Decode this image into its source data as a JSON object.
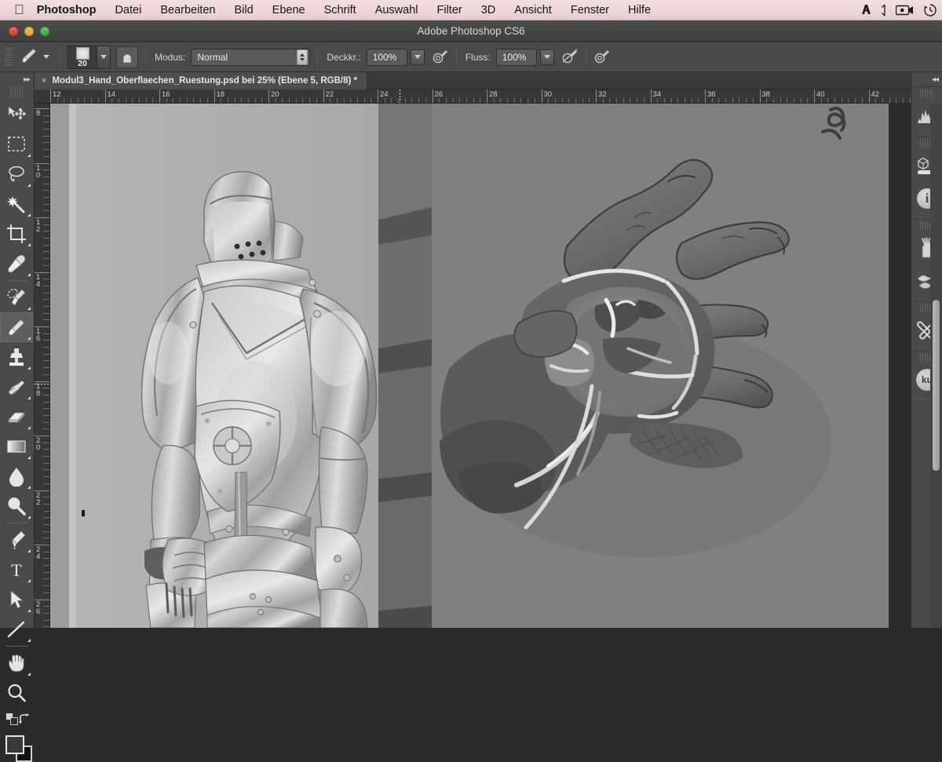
{
  "menubar": {
    "apple_icon": "apple-logo-icon",
    "items": [
      {
        "label": "Photoshop",
        "bold": true
      },
      {
        "label": "Datei"
      },
      {
        "label": "Bearbeiten"
      },
      {
        "label": "Bild"
      },
      {
        "label": "Ebene"
      },
      {
        "label": "Schrift"
      },
      {
        "label": "Auswahl"
      },
      {
        "label": "Filter"
      },
      {
        "label": "3D"
      },
      {
        "label": "Ansicht"
      },
      {
        "label": "Fenster"
      },
      {
        "label": "Hilfe"
      }
    ],
    "tray": [
      "adobe-cc-icon",
      "bluetooth-icon",
      "screen-recording-icon",
      "time-machine-icon"
    ],
    "background": "#ecd6d6"
  },
  "window": {
    "title": "Adobe Photoshop CS6",
    "traffic_lights": [
      "close",
      "minimize",
      "zoom"
    ]
  },
  "options_bar": {
    "tool_preset_icon": "brush-tool-icon",
    "brush_size": "20",
    "tablet_pressure_icon": "tablet-pressure-icon",
    "mode_label": "Modus:",
    "mode_value": "Normal",
    "opacity_label": "Deckkr.:",
    "opacity_value": "100%",
    "opacity_pressure_icon": "pressure-opacity-icon",
    "flow_label": "Fluss:",
    "flow_value": "100%",
    "flow_pressure_icon": "pressure-flow-icon",
    "airbrush_icon": "airbrush-icon"
  },
  "document": {
    "tab_close_glyph": "×",
    "tab_title": "Modul3_Hand_Oberflaechen_Ruestung.psd bei 25% (Ebene 5, RGB/8) *",
    "zoom": "25%",
    "layer": "Ebene 5",
    "color_mode": "RGB/8"
  },
  "rulers": {
    "horizontal_labels": [
      "12",
      "14",
      "16",
      "18",
      "20",
      "22",
      "24",
      "26",
      "28",
      "30",
      "32",
      "34",
      "36",
      "38",
      "40",
      "42"
    ],
    "vertical_labels": [
      "8",
      "10",
      "12",
      "14",
      "16",
      "18",
      "20",
      "22",
      "24",
      "26"
    ],
    "units_step": 2
  },
  "toolbar": {
    "collapse_glyph": "▸▸",
    "tools": [
      {
        "name": "move-tool",
        "label": "Verschieben"
      },
      {
        "name": "rectangular-marquee-tool",
        "label": "Auswahlrechteck"
      },
      {
        "name": "lasso-tool",
        "label": "Lasso"
      },
      {
        "name": "magic-wand-tool",
        "label": "Zauberstab"
      },
      {
        "name": "crop-tool",
        "label": "Freistellen"
      },
      {
        "name": "eyedropper-tool",
        "label": "Pipette"
      },
      {
        "name": "healing-brush-tool",
        "label": "Reparatur-Pinsel"
      },
      {
        "name": "brush-tool",
        "label": "Pinsel",
        "selected": true
      },
      {
        "name": "clone-stamp-tool",
        "label": "Kopierstempel"
      },
      {
        "name": "history-brush-tool",
        "label": "Protokollpinsel"
      },
      {
        "name": "eraser-tool",
        "label": "Radiergummi"
      },
      {
        "name": "gradient-tool",
        "label": "Verlauf"
      },
      {
        "name": "blur-tool",
        "label": "Weichzeichner"
      },
      {
        "name": "dodge-tool",
        "label": "Abwedler"
      },
      {
        "name": "pen-tool",
        "label": "Zeichenstift"
      },
      {
        "name": "type-tool",
        "label": "Text"
      },
      {
        "name": "path-selection-tool",
        "label": "Pfadauswahl"
      },
      {
        "name": "line-tool",
        "label": "Linie"
      },
      {
        "name": "hand-tool",
        "label": "Hand"
      },
      {
        "name": "zoom-tool",
        "label": "Zoom"
      }
    ],
    "swap_colors_icon": "swap-colors-icon",
    "default_colors_icon": "default-colors-icon",
    "foreground_color": "#3a3a3a",
    "background_color": "#111111"
  },
  "right_dock": {
    "collapse_glyph": "◂◂",
    "groups": [
      {
        "icons": [
          {
            "name": "histogram-panel-icon"
          }
        ]
      },
      {
        "icons": [
          {
            "name": "3d-panel-icon"
          },
          {
            "name": "info-panel-icon",
            "glyph": "i"
          }
        ]
      },
      {
        "icons": [
          {
            "name": "brush-panel-icon"
          },
          {
            "name": "brush-presets-panel-icon"
          }
        ]
      },
      {
        "icons": [
          {
            "name": "tool-presets-panel-icon"
          }
        ]
      },
      {
        "icons": [
          {
            "name": "kuler-panel-icon",
            "glyph": "ku"
          }
        ]
      }
    ]
  },
  "canvas": {
    "artboard_color": "#808080",
    "pasteboard_color": "#6f6f6f",
    "left_image_caption": "grayscale-photo-knight-armor",
    "right_image_caption": "digital-painting-armored-gauntlet",
    "scrollbar_visible": true
  }
}
